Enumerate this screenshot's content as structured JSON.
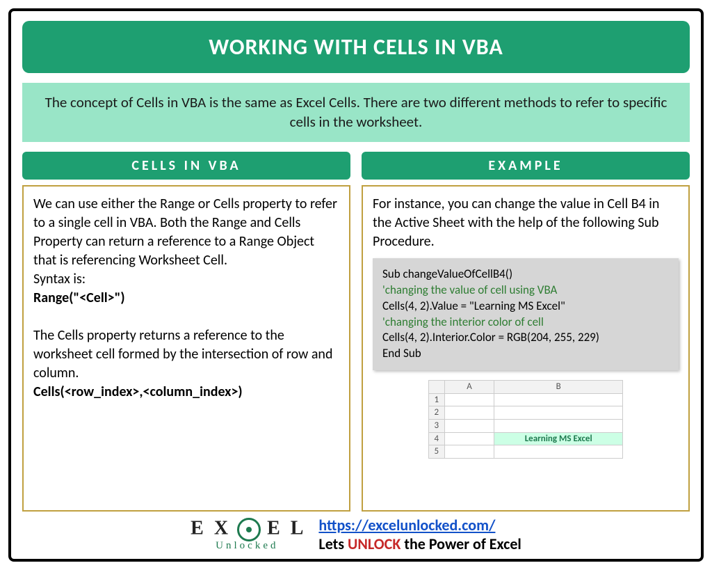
{
  "title": "WORKING WITH CELLS IN VBA",
  "intro": "The concept of Cells in VBA is the same as Excel Cells. There are two different methods to refer to specific cells in the worksheet.",
  "left": {
    "header": "CELLS IN VBA",
    "p1": "We can use either the Range or Cells property to refer to a single cell in VBA. Both the Range and Cells Property can return a reference to a Range Object that is referencing Worksheet Cell.",
    "syntax_label": "Syntax is:",
    "syntax_code": "Range(\"<Cell>\")",
    "p2": "The Cells property returns a reference to the worksheet cell formed by the intersection of row and column.",
    "cells_code": "Cells(<row_index>,<column_index>)"
  },
  "right": {
    "header": "EXAMPLE",
    "intro": "For instance, you can change the value in Cell B4 in the Active Sheet with the help of the following Sub Procedure.",
    "code": {
      "l1": "Sub changeValueOfCellB4()",
      "l2": "'changing the value of cell using VBA",
      "l3": "Cells(4, 2).Value = \"Learning MS Excel\"",
      "l4": "'changing the interior color of cell",
      "l5": "Cells(4, 2).Interior.Color = RGB(204, 255, 229)",
      "l6": "End Sub"
    },
    "sheet": {
      "colA": "A",
      "colB": "B",
      "rows": [
        "1",
        "2",
        "3",
        "4",
        "5"
      ],
      "b4": "Learning MS Excel"
    }
  },
  "footer": {
    "logo_top": "EX  EL",
    "logo_bot": "Unlocked",
    "url": "https://excelunlocked.com/",
    "tag_pre": "Lets ",
    "tag_unlock": "UNLOCK",
    "tag_post": " the Power of Excel"
  }
}
